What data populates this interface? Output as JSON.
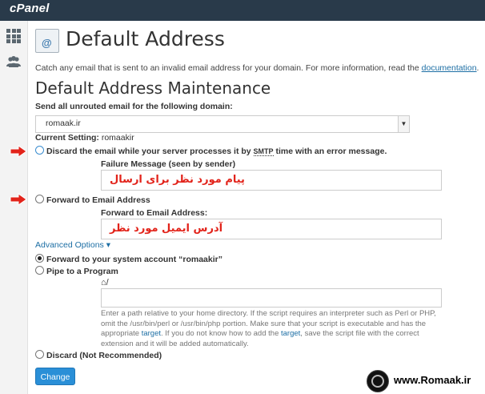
{
  "app": {
    "logo": "cPanel"
  },
  "page": {
    "title": "Default Address",
    "intro_text": "Catch any email that is sent to an invalid email address for your domain. For more information, read the ",
    "intro_link": "documentation",
    "intro_end": "."
  },
  "section": {
    "title": "Default Address Maintenance",
    "domain_label": "Send all unrouted email for the following domain:",
    "domain_value": "romaak.ir",
    "current_setting_label": "Current Setting:",
    "current_setting_value": "romaakir"
  },
  "options": {
    "discard_pre": "Discard the email while your server processes it by ",
    "discard_smtp": "SMTP",
    "discard_post": " time with an error message.",
    "failure_label": "Failure Message (seen by sender)",
    "failure_value": "پیام مورد نظر برای ارسال",
    "forward_label": "Forward to Email Address",
    "forward_field_label": "Forward to Email Address:",
    "forward_value": "آدرس ایمیل مورد نظر",
    "advanced_label": "Advanced Options",
    "advanced_caret": "▾",
    "system_account_label": "Forward to your system account “romaakir”",
    "pipe_label": "Pipe to a Program",
    "home_glyph": "⌂",
    "home_slash": "/",
    "help_1": "Enter a path relative to your home directory. If the script requires an interpreter such as Perl or PHP, omit the /usr/bin/perl or /usr/bin/php portion. Make sure that your script is executable and has the appropriate ",
    "help_link1": "target",
    "help_2": ". If you do not know how to add the ",
    "help_link2": "target",
    "help_3": ", save the script file with the correct extension and it will be added automatically.",
    "discard_nr_label": "Discard (Not Recommended)",
    "change_button": "Change"
  },
  "watermark": {
    "text": "www.Romaak.ir"
  },
  "colors": {
    "topbar": "#293a4a",
    "link": "#1c6ea4",
    "button": "#2a8fd7",
    "annotation_red": "#e2231a"
  },
  "icons": [
    "grid-icon",
    "users-icon",
    "envelope-at-icon",
    "home-icon",
    "red-arrow-icon"
  ]
}
